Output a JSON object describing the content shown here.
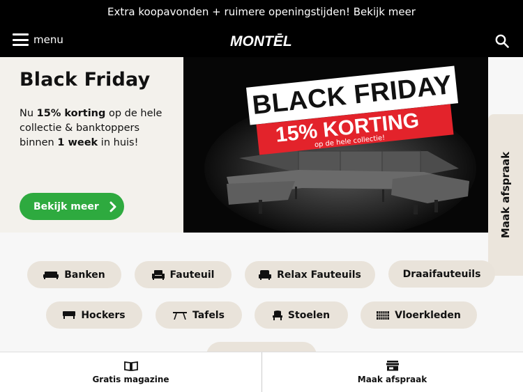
{
  "announcement": "Extra koopavonden + ruimere openingstijden! Bekijk meer",
  "header": {
    "menu_label": "menu",
    "logo_text": "MONTĒL",
    "search_icon": "search-icon"
  },
  "hero": {
    "title": "Black Friday",
    "text_1": "Nu ",
    "text_bold_1": "15% korting",
    "text_2": " op de hele collectie & banktoppers binnen ",
    "text_bold_2": "1 week",
    "text_3": " in huis!",
    "cta_label": "Bekijk meer",
    "banner_line_1": "BLACK FRIDAY",
    "banner_line_2": "15% KORTING",
    "banner_line_3": "op de hele collectie!"
  },
  "side_tab": "Maak afspraak",
  "categories": [
    {
      "label": "Banken",
      "icon": "sofa-icon"
    },
    {
      "label": "Fauteuil",
      "icon": "armchair-icon"
    },
    {
      "label": "Relax Fauteuils",
      "icon": "recliner-icon"
    },
    {
      "label": "Draaifauteuils",
      "icon": ""
    },
    {
      "label": "Hockers",
      "icon": "ottoman-icon"
    },
    {
      "label": "Tafels",
      "icon": "table-icon"
    },
    {
      "label": "Stoelen",
      "icon": "chair-icon"
    },
    {
      "label": "Vloerkleden",
      "icon": "rug-icon"
    }
  ],
  "bottom_bar": [
    {
      "label": "Gratis magazine",
      "icon": "book-icon"
    },
    {
      "label": "Maak afspraak",
      "icon": "store-icon"
    }
  ],
  "colors": {
    "accent_green": "#2eaa3f",
    "sale_red": "#e3232b",
    "pill_bg": "#e9e3da"
  }
}
